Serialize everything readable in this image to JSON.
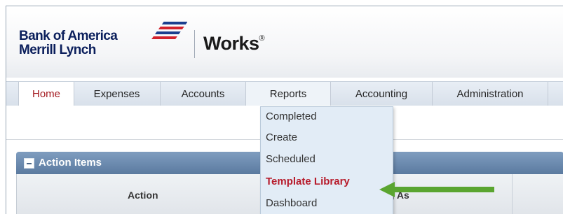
{
  "header": {
    "brand_line1": "Bank of America",
    "brand_line2": "Merrill Lynch",
    "product_name": "Works",
    "product_mark": "®"
  },
  "nav": {
    "items": [
      {
        "label": "Home",
        "active": true
      },
      {
        "label": "Expenses"
      },
      {
        "label": "Accounts"
      },
      {
        "label": "Reports",
        "open": true
      },
      {
        "label": "Accounting"
      },
      {
        "label": "Administration"
      }
    ]
  },
  "reports_menu": {
    "items": [
      {
        "label": "Completed"
      },
      {
        "label": "Create"
      },
      {
        "label": "Scheduled"
      },
      {
        "label": "Template Library",
        "highlighted": true
      },
      {
        "label": "Dashboard"
      }
    ]
  },
  "panel": {
    "title": "Action Items",
    "columns": [
      "Action",
      "g As"
    ]
  },
  "colors": {
    "brand_navy": "#0b1f5c",
    "nav_accent": "#b51f2c",
    "highlight_text": "#b71c2c",
    "panel_header": "#6788ad",
    "arrow_green": "#5aa530",
    "flag_blue": "#1b3f8f",
    "flag_red": "#d2222d"
  },
  "icons": {
    "brand_flag": "flag-icon",
    "panel_toggle": "minus-icon",
    "pointer_arrow": "arrow-left-icon"
  }
}
